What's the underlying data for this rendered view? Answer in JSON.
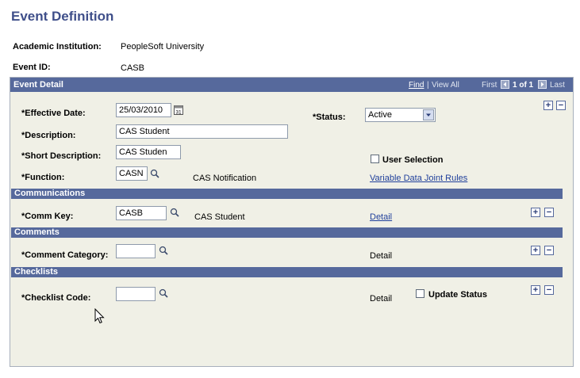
{
  "page": {
    "title": "Event Definition"
  },
  "header": {
    "institution_label": "Academic Institution:",
    "institution_value": "PeopleSoft University",
    "event_id_label": "Event ID:",
    "event_id_value": "CASB"
  },
  "event_detail": {
    "title": "Event Detail",
    "nav": {
      "find": "Find",
      "separator": "|",
      "view_all": "View All",
      "first": "First",
      "range": "1 of 1",
      "last": "Last"
    },
    "effective_date_label": "*Effective Date:",
    "effective_date_value": "25/03/2010",
    "status_label": "*Status:",
    "status_value": "Active",
    "description_label": "*Description:",
    "description_value": "CAS Student",
    "short_description_label": "*Short Description:",
    "short_description_value": "CAS Studen",
    "user_selection_label": "User Selection",
    "function_label": "*Function:",
    "function_value": "CASN",
    "function_desc": "CAS Notification",
    "variable_link": "Variable Data Joint Rules"
  },
  "communications": {
    "title": "Communications",
    "comm_key_label": "*Comm Key:",
    "comm_key_value": "CASB",
    "comm_key_desc": "CAS Student",
    "detail_link": "Detail"
  },
  "comments": {
    "title": "Comments",
    "category_label": "*Comment Category:",
    "category_value": "",
    "detail_label": "Detail"
  },
  "checklists": {
    "title": "Checklists",
    "code_label": "*Checklist Code:",
    "code_value": "",
    "detail_label": "Detail",
    "update_status_label": "Update Status"
  },
  "icons": {
    "add": "+",
    "remove": "−",
    "calendar_glyph": "31"
  }
}
